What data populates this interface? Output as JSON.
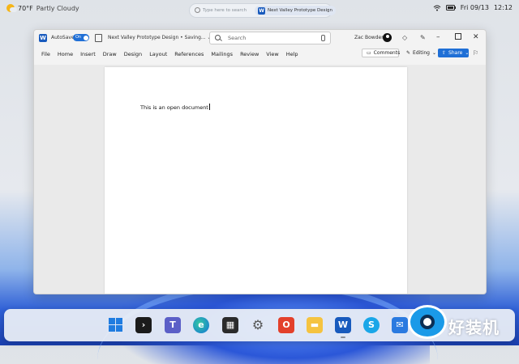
{
  "topbar": {
    "weather_temp": "70°F",
    "weather_condition": "Partly Cloudy",
    "search_placeholder": "Type here to search",
    "recent_doc": "Next Valley Prototype Design",
    "date": "Fri 09/13",
    "time": "12:12",
    "icons": [
      "weather-icon",
      "search-icon",
      "word-icon",
      "wifi-icon",
      "battery-icon"
    ]
  },
  "window": {
    "app_logo": "W",
    "autosave_label": "AutoSave",
    "autosave_state": "On",
    "doc_title": "Next Valley Prototype Design • Saving... ⌄",
    "search_placeholder": "Search",
    "user_name": "Zac Bowden",
    "controls": {
      "minimize": "–",
      "close": "✕"
    }
  },
  "menubar": {
    "items": [
      "File",
      "Home",
      "Insert",
      "Draw",
      "Design",
      "Layout",
      "References",
      "Mailings",
      "Review",
      "View",
      "Help"
    ],
    "comments_label": "Comments",
    "editing_label": "Editing",
    "share_label": "Share"
  },
  "document": {
    "body_text": "This is an open document"
  },
  "taskbar": {
    "apps": [
      "start",
      "terminal",
      "teams",
      "edge",
      "store",
      "settings",
      "office",
      "file-explorer",
      "word",
      "skype",
      "mail"
    ]
  },
  "watermark": {
    "text": "好装机"
  },
  "colors": {
    "accent": "#1f6fd6",
    "word_blue": "#185abd",
    "window_bg": "#f3f3f3"
  }
}
